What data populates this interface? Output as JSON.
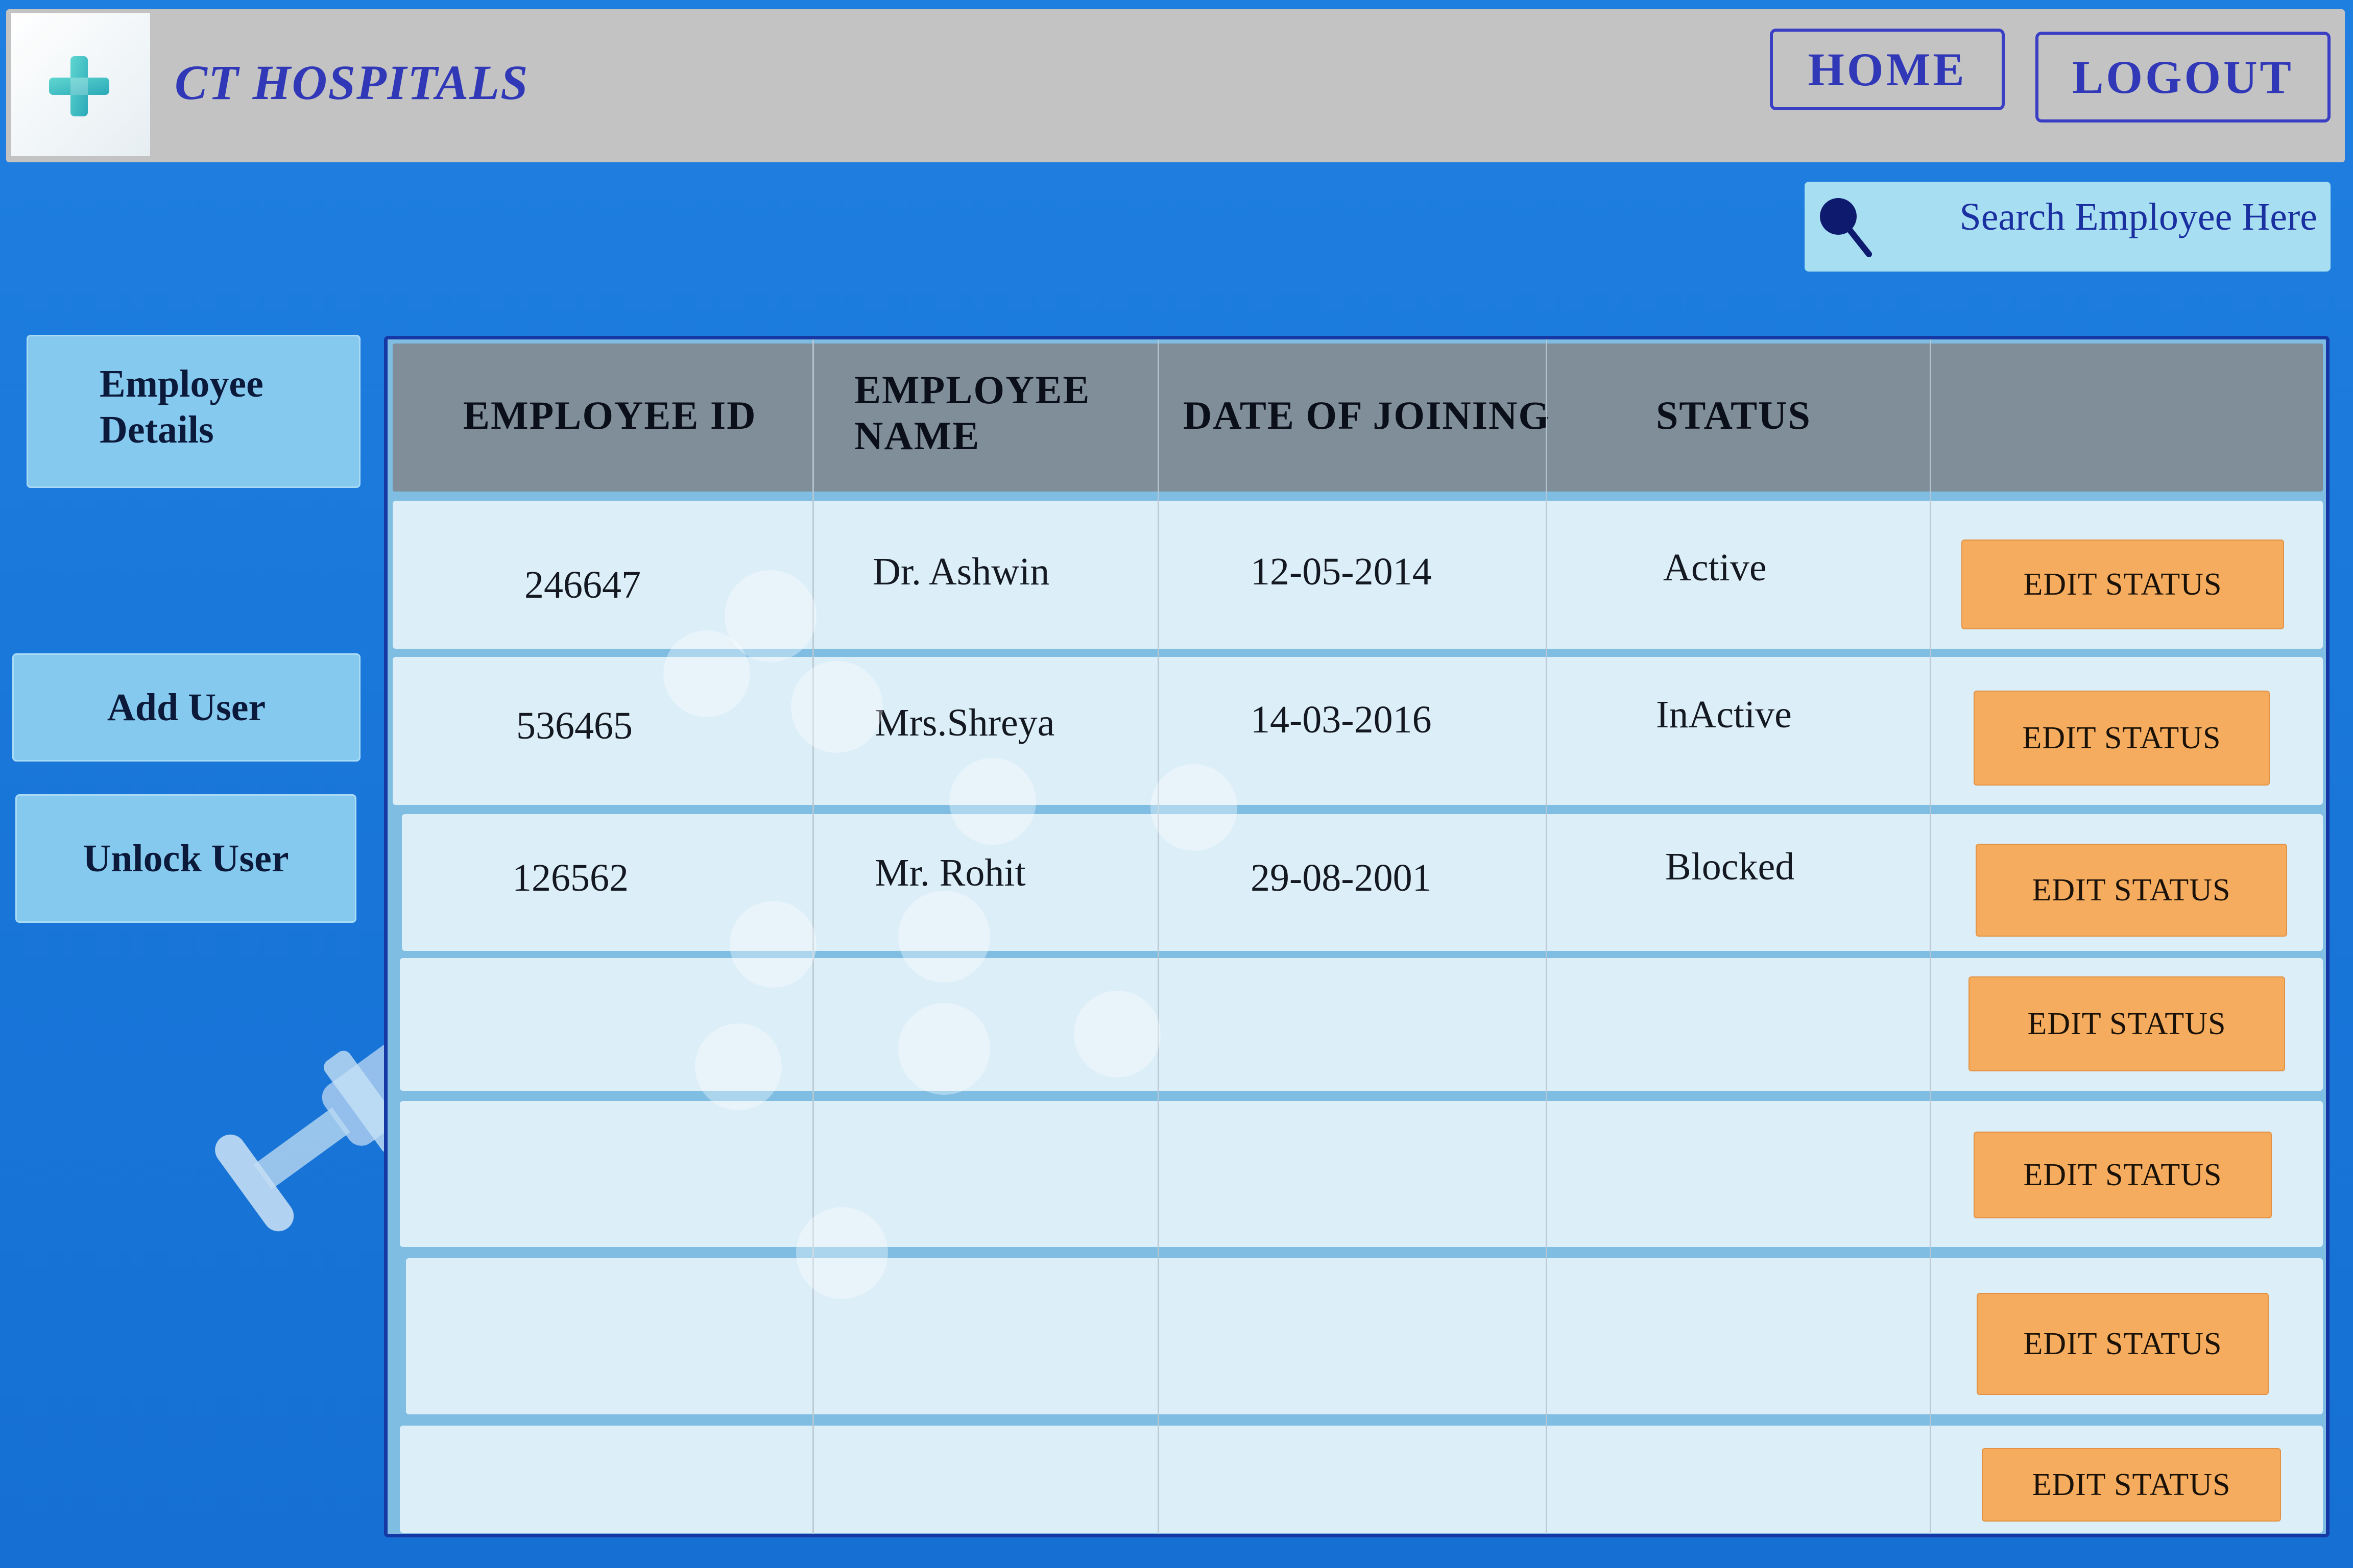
{
  "header": {
    "brand": "CT HOSPITALS",
    "home_label": "HOME",
    "logout_label": "LOGOUT"
  },
  "search": {
    "placeholder": "Search Employee Here"
  },
  "sidebar": {
    "items": [
      {
        "label": "Employee Details"
      },
      {
        "label": "Add User"
      },
      {
        "label": "Unlock User"
      }
    ]
  },
  "table": {
    "headers": [
      "EMPLOYEE ID",
      "EMPLOYEE NAME",
      "DATE OF JOINING",
      "STATUS",
      ""
    ],
    "rows": [
      {
        "id": "246647",
        "name": "Dr. Ashwin",
        "doj": "12-05-2014",
        "status": "Active",
        "action": "EDIT STATUS"
      },
      {
        "id": "536465",
        "name": "Mrs.Shreya",
        "doj": "14-03-2016",
        "status": "InActive",
        "action": "EDIT STATUS"
      },
      {
        "id": "126562",
        "name": "Mr. Rohit",
        "doj": "29-08-2001",
        "status": "Blocked",
        "action": "EDIT STATUS"
      },
      {
        "id": "",
        "name": "",
        "doj": "",
        "status": "",
        "action": "EDIT STATUS"
      },
      {
        "id": "",
        "name": "",
        "doj": "",
        "status": "",
        "action": "EDIT STATUS"
      },
      {
        "id": "",
        "name": "",
        "doj": "",
        "status": "",
        "action": "EDIT STATUS"
      },
      {
        "id": "",
        "name": "",
        "doj": "",
        "status": "",
        "action": "EDIT STATUS"
      }
    ]
  },
  "colors": {
    "background": "#1a78da",
    "header_bg": "#c3c3c3",
    "brand_color": "#3038b8",
    "table_header_bg": "#7f8e99",
    "row_bg": "#dceef8",
    "edit_button": "#f5ac5e",
    "sidebar_button": "#86c9ef",
    "search_bg": "#a7def1"
  },
  "icons": {
    "logo": "medical-cross-icon",
    "search": "search-icon"
  }
}
